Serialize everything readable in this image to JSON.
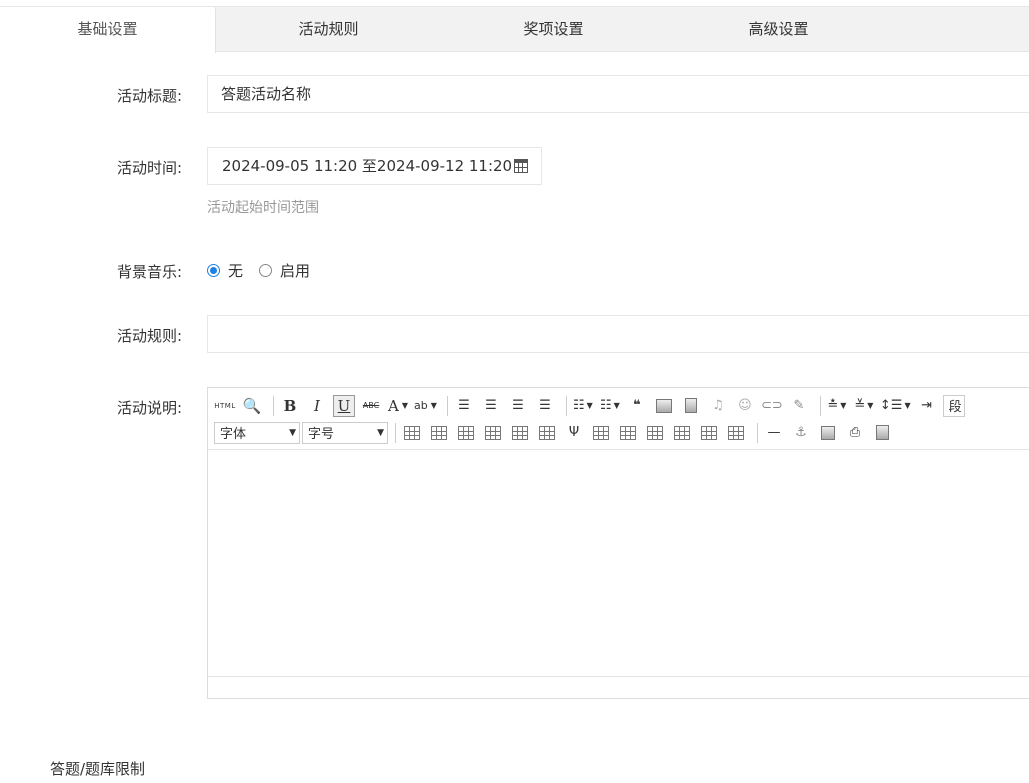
{
  "tabs": [
    {
      "label": "基础设置",
      "active": true
    },
    {
      "label": "活动规则",
      "active": false
    },
    {
      "label": "奖项设置",
      "active": false
    },
    {
      "label": "高级设置",
      "active": false
    }
  ],
  "form": {
    "title_label": "活动标题:",
    "title_value": "答题活动名称",
    "time_label": "活动时间:",
    "time_value": "2024-09-05 11:20 至2024-09-12 11:20",
    "time_hint": "活动起始时间范围",
    "music_label": "背景音乐:",
    "music_options": [
      {
        "label": "无",
        "checked": true
      },
      {
        "label": "启用",
        "checked": false
      }
    ],
    "rules_label": "活动规则:",
    "rules_value": "",
    "desc_label": "活动说明:"
  },
  "editor": {
    "html_btn": "HTML",
    "bold": "B",
    "italic": "I",
    "underline": "U",
    "strike": "ABC",
    "fontcolor": "A",
    "backcolor": "ab",
    "paragraph": "段",
    "font_family": "字体",
    "font_size": "字号",
    "quote": "66",
    "hr": "—"
  },
  "section": {
    "title": "答题/题库限制"
  },
  "colors": {
    "accent": "#1e7fe6",
    "hint": "#999999",
    "tab_bar": "#f2f2f2"
  }
}
